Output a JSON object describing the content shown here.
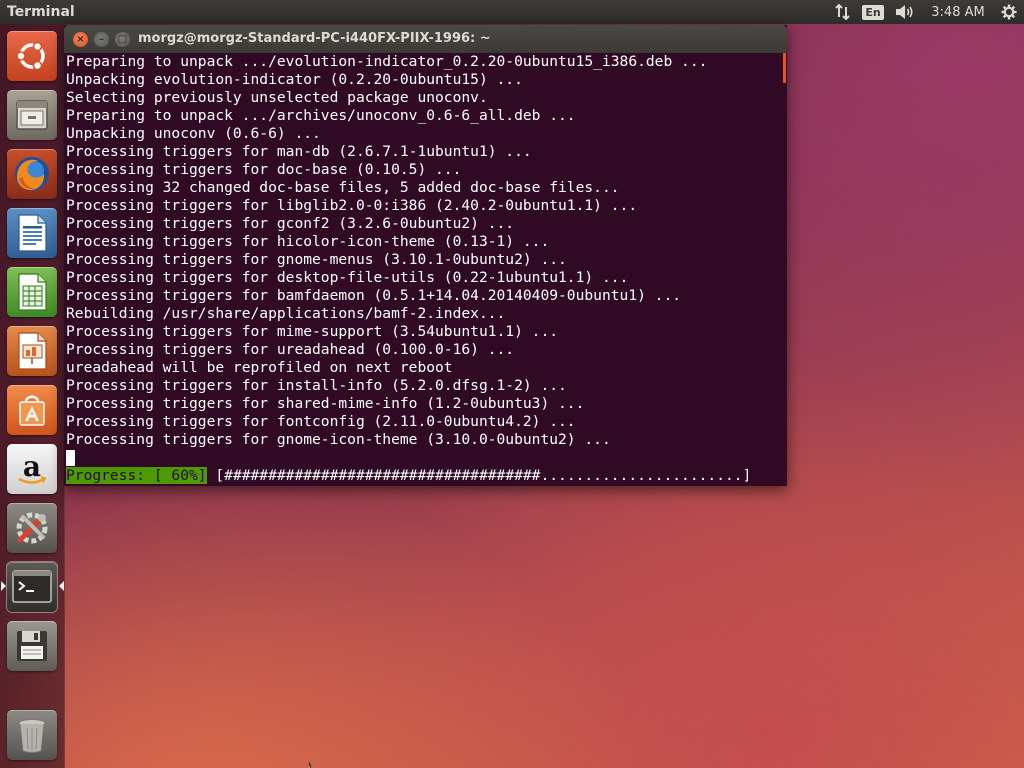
{
  "top_panel": {
    "app_title": "Terminal",
    "keyboard_layout": "En",
    "clock": "3:48 AM"
  },
  "launcher": {
    "items": [
      {
        "name": "dash-home",
        "icon": "ubuntu-logo-icon"
      },
      {
        "name": "files",
        "icon": "file-cabinet-icon"
      },
      {
        "name": "firefox",
        "icon": "firefox-icon"
      },
      {
        "name": "libreoffice-writer",
        "icon": "writer-document-icon"
      },
      {
        "name": "libreoffice-calc",
        "icon": "calc-spreadsheet-icon"
      },
      {
        "name": "libreoffice-impress",
        "icon": "impress-presentation-icon"
      },
      {
        "name": "ubuntu-software-center",
        "icon": "shopping-bag-icon"
      },
      {
        "name": "amazon",
        "icon": "amazon-icon"
      },
      {
        "name": "system-settings",
        "icon": "wrench-screwdriver-icon"
      },
      {
        "name": "terminal",
        "icon": "terminal-icon"
      },
      {
        "name": "save-floppy",
        "icon": "floppy-disk-icon"
      },
      {
        "name": "trash",
        "icon": "trash-icon"
      }
    ]
  },
  "terminal": {
    "title": "morgz@morgz-Standard-PC-i440FX-PIIX-1996: ~",
    "close_glyph": "×",
    "minimize_glyph": "–",
    "maximize_glyph": "□",
    "lines": [
      "Preparing to unpack .../evolution-indicator_0.2.20-0ubuntu15_i386.deb ...",
      "Unpacking evolution-indicator (0.2.20-0ubuntu15) ...",
      "Selecting previously unselected package unoconv.",
      "Preparing to unpack .../archives/unoconv_0.6-6_all.deb ...",
      "Unpacking unoconv (0.6-6) ...",
      "Processing triggers for man-db (2.6.7.1-1ubuntu1) ...",
      "Processing triggers for doc-base (0.10.5) ...",
      "Processing 32 changed doc-base files, 5 added doc-base files...",
      "Processing triggers for libglib2.0-0:i386 (2.40.2-0ubuntu1.1) ...",
      "Processing triggers for gconf2 (3.2.6-0ubuntu2) ...",
      "Processing triggers for hicolor-icon-theme (0.13-1) ...",
      "Processing triggers for gnome-menus (3.10.1-0ubuntu2) ...",
      "Processing triggers for desktop-file-utils (0.22-1ubuntu1.1) ...",
      "Processing triggers for bamfdaemon (0.5.1+14.04.20140409-0ubuntu1) ...",
      "Rebuilding /usr/share/applications/bamf-2.index...",
      "Processing triggers for mime-support (3.54ubuntu1.1) ...",
      "Processing triggers for ureadahead (0.100.0-16) ...",
      "ureadahead will be reprofiled on next reboot",
      "Processing triggers for install-info (5.2.0.dfsg.1-2) ...",
      "Processing triggers for shared-mime-info (1.2-0ubuntu3) ...",
      "Processing triggers for fontconfig (2.11.0-0ubuntu4.2) ...",
      "Processing triggers for gnome-icon-theme (3.10.0-0ubuntu2) ..."
    ],
    "progress_label": "Progress: [ 60%]",
    "progress_bar": " [####################################.......................]",
    "progress_percent": 60
  },
  "colors": {
    "terminal_bg": "#300a24",
    "progress_label_bg": "#4e9a06",
    "close_button": "#e95420",
    "panel_bg": "#3c3b37"
  }
}
